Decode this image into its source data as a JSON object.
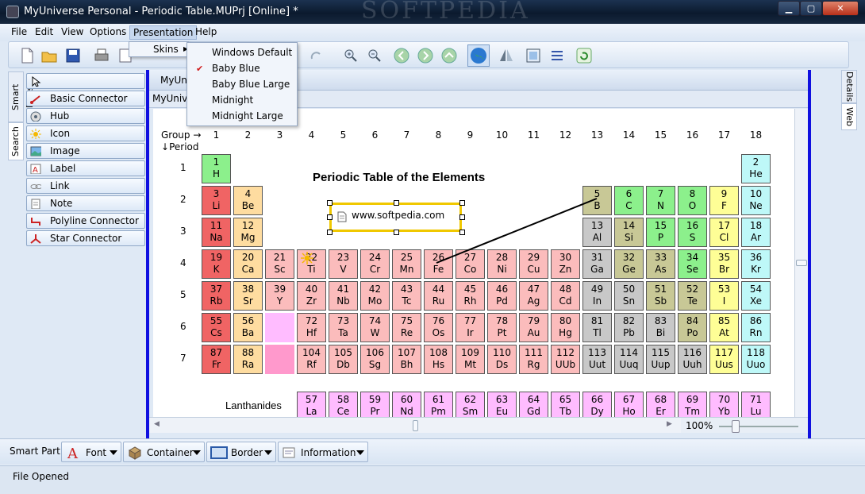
{
  "window": {
    "title": "MyUniverse Personal - Periodic Table.MUPrj [Online] *",
    "watermark": "SOFTPEDIA"
  },
  "menubar": {
    "items": [
      "File",
      "Edit",
      "View",
      "Options",
      "Presentation",
      "Help"
    ]
  },
  "presentation_menu": {
    "skins_label": "Skins"
  },
  "skins_submenu": {
    "items": [
      "Windows Default",
      "Baby Blue",
      "Baby Blue Large",
      "Midnight",
      "Midnight Large"
    ],
    "checked": "Baby Blue"
  },
  "left_tabs": [
    "Smart Parts",
    "Search"
  ],
  "smart_parts": [
    "Basic Connector",
    "Hub",
    "Icon",
    "Image",
    "Label",
    "Link",
    "Note",
    "Polyline Connector",
    "Star Connector"
  ],
  "doc": {
    "tab1": "MyUniverse",
    "tab2": "MyUniverse"
  },
  "right_tabs": [
    "Details",
    "Web"
  ],
  "table": {
    "title": "Periodic Table of the Elements",
    "group_label": "Group",
    "period_label": "Period",
    "groups": [
      "1",
      "2",
      "3",
      "4",
      "5",
      "6",
      "7",
      "8",
      "9",
      "10",
      "11",
      "12",
      "13",
      "14",
      "15",
      "16",
      "17",
      "18"
    ],
    "periods": [
      "1",
      "2",
      "3",
      "4",
      "5",
      "6",
      "7"
    ],
    "link_text": "www.softpedia.com",
    "lanthanides_label": "Lanthanides",
    "elements": [
      {
        "n": "1",
        "s": "H",
        "r": 1,
        "c": 1,
        "t": "c-nonm"
      },
      {
        "n": "2",
        "s": "He",
        "r": 1,
        "c": 18,
        "t": "c-noble"
      },
      {
        "n": "3",
        "s": "Li",
        "r": 2,
        "c": 1,
        "t": "c-alk"
      },
      {
        "n": "4",
        "s": "Be",
        "r": 2,
        "c": 2,
        "t": "c-alkE"
      },
      {
        "n": "5",
        "s": "B",
        "r": 2,
        "c": 13,
        "t": "c-met"
      },
      {
        "n": "6",
        "s": "C",
        "r": 2,
        "c": 14,
        "t": "c-nonm"
      },
      {
        "n": "7",
        "s": "N",
        "r": 2,
        "c": 15,
        "t": "c-nonm"
      },
      {
        "n": "8",
        "s": "O",
        "r": 2,
        "c": 16,
        "t": "c-nonm"
      },
      {
        "n": "9",
        "s": "F",
        "r": 2,
        "c": 17,
        "t": "c-hal"
      },
      {
        "n": "10",
        "s": "Ne",
        "r": 2,
        "c": 18,
        "t": "c-noble"
      },
      {
        "n": "11",
        "s": "Na",
        "r": 3,
        "c": 1,
        "t": "c-alk"
      },
      {
        "n": "12",
        "s": "Mg",
        "r": 3,
        "c": 2,
        "t": "c-alkE"
      },
      {
        "n": "13",
        "s": "Al",
        "r": 3,
        "c": 13,
        "t": "c-poor"
      },
      {
        "n": "14",
        "s": "Si",
        "r": 3,
        "c": 14,
        "t": "c-met"
      },
      {
        "n": "15",
        "s": "P",
        "r": 3,
        "c": 15,
        "t": "c-nonm"
      },
      {
        "n": "16",
        "s": "S",
        "r": 3,
        "c": 16,
        "t": "c-nonm"
      },
      {
        "n": "17",
        "s": "Cl",
        "r": 3,
        "c": 17,
        "t": "c-hal"
      },
      {
        "n": "18",
        "s": "Ar",
        "r": 3,
        "c": 18,
        "t": "c-noble"
      },
      {
        "n": "19",
        "s": "K",
        "r": 4,
        "c": 1,
        "t": "c-alk"
      },
      {
        "n": "20",
        "s": "Ca",
        "r": 4,
        "c": 2,
        "t": "c-alkE"
      },
      {
        "n": "21",
        "s": "Sc",
        "r": 4,
        "c": 3,
        "t": "c-trans"
      },
      {
        "n": "22",
        "s": "Ti",
        "r": 4,
        "c": 4,
        "t": "c-trans"
      },
      {
        "n": "23",
        "s": "V",
        "r": 4,
        "c": 5,
        "t": "c-trans"
      },
      {
        "n": "24",
        "s": "Cr",
        "r": 4,
        "c": 6,
        "t": "c-trans"
      },
      {
        "n": "25",
        "s": "Mn",
        "r": 4,
        "c": 7,
        "t": "c-trans"
      },
      {
        "n": "26",
        "s": "Fe",
        "r": 4,
        "c": 8,
        "t": "c-trans"
      },
      {
        "n": "27",
        "s": "Co",
        "r": 4,
        "c": 9,
        "t": "c-trans"
      },
      {
        "n": "28",
        "s": "Ni",
        "r": 4,
        "c": 10,
        "t": "c-trans"
      },
      {
        "n": "29",
        "s": "Cu",
        "r": 4,
        "c": 11,
        "t": "c-trans"
      },
      {
        "n": "30",
        "s": "Zn",
        "r": 4,
        "c": 12,
        "t": "c-trans"
      },
      {
        "n": "31",
        "s": "Ga",
        "r": 4,
        "c": 13,
        "t": "c-poor"
      },
      {
        "n": "32",
        "s": "Ge",
        "r": 4,
        "c": 14,
        "t": "c-met"
      },
      {
        "n": "33",
        "s": "As",
        "r": 4,
        "c": 15,
        "t": "c-met"
      },
      {
        "n": "34",
        "s": "Se",
        "r": 4,
        "c": 16,
        "t": "c-nonm"
      },
      {
        "n": "35",
        "s": "Br",
        "r": 4,
        "c": 17,
        "t": "c-hal"
      },
      {
        "n": "36",
        "s": "Kr",
        "r": 4,
        "c": 18,
        "t": "c-noble"
      },
      {
        "n": "37",
        "s": "Rb",
        "r": 5,
        "c": 1,
        "t": "c-alk"
      },
      {
        "n": "38",
        "s": "Sr",
        "r": 5,
        "c": 2,
        "t": "c-alkE"
      },
      {
        "n": "39",
        "s": "Y",
        "r": 5,
        "c": 3,
        "t": "c-trans"
      },
      {
        "n": "40",
        "s": "Zr",
        "r": 5,
        "c": 4,
        "t": "c-trans"
      },
      {
        "n": "41",
        "s": "Nb",
        "r": 5,
        "c": 5,
        "t": "c-trans"
      },
      {
        "n": "42",
        "s": "Mo",
        "r": 5,
        "c": 6,
        "t": "c-trans"
      },
      {
        "n": "43",
        "s": "Tc",
        "r": 5,
        "c": 7,
        "t": "c-trans"
      },
      {
        "n": "44",
        "s": "Ru",
        "r": 5,
        "c": 8,
        "t": "c-trans"
      },
      {
        "n": "45",
        "s": "Rh",
        "r": 5,
        "c": 9,
        "t": "c-trans"
      },
      {
        "n": "46",
        "s": "Pd",
        "r": 5,
        "c": 10,
        "t": "c-trans"
      },
      {
        "n": "47",
        "s": "Ag",
        "r": 5,
        "c": 11,
        "t": "c-trans"
      },
      {
        "n": "48",
        "s": "Cd",
        "r": 5,
        "c": 12,
        "t": "c-trans"
      },
      {
        "n": "49",
        "s": "In",
        "r": 5,
        "c": 13,
        "t": "c-poor"
      },
      {
        "n": "50",
        "s": "Sn",
        "r": 5,
        "c": 14,
        "t": "c-poor"
      },
      {
        "n": "51",
        "s": "Sb",
        "r": 5,
        "c": 15,
        "t": "c-met"
      },
      {
        "n": "52",
        "s": "Te",
        "r": 5,
        "c": 16,
        "t": "c-met"
      },
      {
        "n": "53",
        "s": "I",
        "r": 5,
        "c": 17,
        "t": "c-hal"
      },
      {
        "n": "54",
        "s": "Xe",
        "r": 5,
        "c": 18,
        "t": "c-noble"
      },
      {
        "n": "55",
        "s": "Cs",
        "r": 6,
        "c": 1,
        "t": "c-alk"
      },
      {
        "n": "56",
        "s": "Ba",
        "r": 6,
        "c": 2,
        "t": "c-alkE"
      },
      {
        "n": "",
        "s": "",
        "r": 6,
        "c": 3,
        "t": "c-lan"
      },
      {
        "n": "72",
        "s": "Hf",
        "r": 6,
        "c": 4,
        "t": "c-trans"
      },
      {
        "n": "73",
        "s": "Ta",
        "r": 6,
        "c": 5,
        "t": "c-trans"
      },
      {
        "n": "74",
        "s": "W",
        "r": 6,
        "c": 6,
        "t": "c-trans"
      },
      {
        "n": "75",
        "s": "Re",
        "r": 6,
        "c": 7,
        "t": "c-trans"
      },
      {
        "n": "76",
        "s": "Os",
        "r": 6,
        "c": 8,
        "t": "c-trans"
      },
      {
        "n": "77",
        "s": "Ir",
        "r": 6,
        "c": 9,
        "t": "c-trans"
      },
      {
        "n": "78",
        "s": "Pt",
        "r": 6,
        "c": 10,
        "t": "c-trans"
      },
      {
        "n": "79",
        "s": "Au",
        "r": 6,
        "c": 11,
        "t": "c-trans"
      },
      {
        "n": "80",
        "s": "Hg",
        "r": 6,
        "c": 12,
        "t": "c-trans"
      },
      {
        "n": "81",
        "s": "Tl",
        "r": 6,
        "c": 13,
        "t": "c-poor"
      },
      {
        "n": "82",
        "s": "Pb",
        "r": 6,
        "c": 14,
        "t": "c-poor"
      },
      {
        "n": "83",
        "s": "Bi",
        "r": 6,
        "c": 15,
        "t": "c-poor"
      },
      {
        "n": "84",
        "s": "Po",
        "r": 6,
        "c": 16,
        "t": "c-met"
      },
      {
        "n": "85",
        "s": "At",
        "r": 6,
        "c": 17,
        "t": "c-hal"
      },
      {
        "n": "86",
        "s": "Rn",
        "r": 6,
        "c": 18,
        "t": "c-noble"
      },
      {
        "n": "87",
        "s": "Fr",
        "r": 7,
        "c": 1,
        "t": "c-alk"
      },
      {
        "n": "88",
        "s": "Ra",
        "r": 7,
        "c": 2,
        "t": "c-alkE"
      },
      {
        "n": "",
        "s": "",
        "r": 7,
        "c": 3,
        "t": "c-act"
      },
      {
        "n": "104",
        "s": "Rf",
        "r": 7,
        "c": 4,
        "t": "c-trans"
      },
      {
        "n": "105",
        "s": "Db",
        "r": 7,
        "c": 5,
        "t": "c-trans"
      },
      {
        "n": "106",
        "s": "Sg",
        "r": 7,
        "c": 6,
        "t": "c-trans"
      },
      {
        "n": "107",
        "s": "Bh",
        "r": 7,
        "c": 7,
        "t": "c-trans"
      },
      {
        "n": "108",
        "s": "Hs",
        "r": 7,
        "c": 8,
        "t": "c-trans"
      },
      {
        "n": "109",
        "s": "Mt",
        "r": 7,
        "c": 9,
        "t": "c-trans"
      },
      {
        "n": "110",
        "s": "Ds",
        "r": 7,
        "c": 10,
        "t": "c-trans"
      },
      {
        "n": "111",
        "s": "Rg",
        "r": 7,
        "c": 11,
        "t": "c-trans"
      },
      {
        "n": "112",
        "s": "UUb",
        "r": 7,
        "c": 12,
        "t": "c-trans"
      },
      {
        "n": "113",
        "s": "Uut",
        "r": 7,
        "c": 13,
        "t": "c-poor"
      },
      {
        "n": "114",
        "s": "Uuq",
        "r": 7,
        "c": 14,
        "t": "c-poor"
      },
      {
        "n": "115",
        "s": "Uup",
        "r": 7,
        "c": 15,
        "t": "c-poor"
      },
      {
        "n": "116",
        "s": "Uuh",
        "r": 7,
        "c": 16,
        "t": "c-poor"
      },
      {
        "n": "117",
        "s": "Uus",
        "r": 7,
        "c": 17,
        "t": "c-hal"
      },
      {
        "n": "118",
        "s": "Uuo",
        "r": 7,
        "c": 18,
        "t": "c-noble"
      },
      {
        "n": "57",
        "s": "La",
        "r": 9,
        "c": 4,
        "t": "c-lan"
      },
      {
        "n": "58",
        "s": "Ce",
        "r": 9,
        "c": 5,
        "t": "c-lan"
      },
      {
        "n": "59",
        "s": "Pr",
        "r": 9,
        "c": 6,
        "t": "c-lan"
      },
      {
        "n": "60",
        "s": "Nd",
        "r": 9,
        "c": 7,
        "t": "c-lan"
      },
      {
        "n": "61",
        "s": "Pm",
        "r": 9,
        "c": 8,
        "t": "c-lan"
      },
      {
        "n": "62",
        "s": "Sm",
        "r": 9,
        "c": 9,
        "t": "c-lan"
      },
      {
        "n": "63",
        "s": "Eu",
        "r": 9,
        "c": 10,
        "t": "c-lan"
      },
      {
        "n": "64",
        "s": "Gd",
        "r": 9,
        "c": 11,
        "t": "c-lan"
      },
      {
        "n": "65",
        "s": "Tb",
        "r": 9,
        "c": 12,
        "t": "c-lan"
      },
      {
        "n": "66",
        "s": "Dy",
        "r": 9,
        "c": 13,
        "t": "c-lan"
      },
      {
        "n": "67",
        "s": "Ho",
        "r": 9,
        "c": 14,
        "t": "c-lan"
      },
      {
        "n": "68",
        "s": "Er",
        "r": 9,
        "c": 15,
        "t": "c-lan"
      },
      {
        "n": "69",
        "s": "Tm",
        "r": 9,
        "c": 16,
        "t": "c-lan"
      },
      {
        "n": "70",
        "s": "Yb",
        "r": 9,
        "c": 17,
        "t": "c-lan"
      },
      {
        "n": "71",
        "s": "Lu",
        "r": 9,
        "c": 18,
        "t": "c-lan"
      }
    ]
  },
  "zoom": {
    "level": "100%"
  },
  "smartbar": {
    "label": "Smart Part:",
    "buttons": [
      "Font",
      "Container",
      "Border",
      "Information"
    ]
  },
  "status": {
    "text": "File Opened"
  },
  "colors": {
    "frame_blue": "#1010e0",
    "selection_yellow": "#f0c800"
  }
}
